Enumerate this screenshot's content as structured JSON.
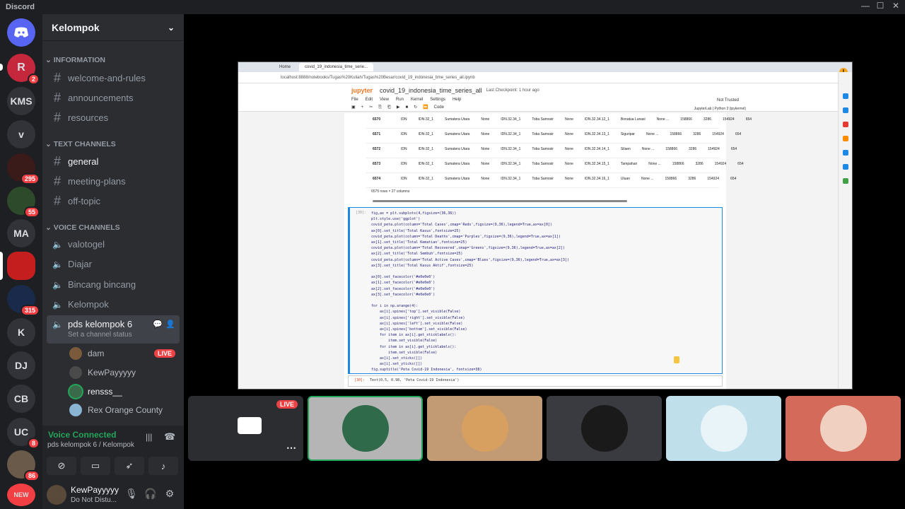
{
  "app": {
    "name": "Discord"
  },
  "window_controls": {
    "minimize": "—",
    "maximize": "☐",
    "close": "✕"
  },
  "servers": [
    {
      "label": "",
      "badge": "2"
    },
    {
      "label": "KMS",
      "badge": ""
    },
    {
      "label": "v",
      "badge": ""
    },
    {
      "label": "",
      "badge": "295"
    },
    {
      "label": "",
      "badge": "55"
    },
    {
      "label": "MA",
      "badge": ""
    },
    {
      "label": "",
      "badge": ""
    },
    {
      "label": "",
      "badge": "315"
    },
    {
      "label": "K",
      "badge": ""
    },
    {
      "label": "DJ",
      "badge": ""
    },
    {
      "label": "CB",
      "badge": ""
    },
    {
      "label": "UC",
      "badge": "8"
    },
    {
      "label": "",
      "badge": "86"
    },
    {
      "label": "NEW",
      "badge": ""
    }
  ],
  "guild": {
    "name": "Kelompok"
  },
  "categories": {
    "information": "INFORMATION",
    "text": "TEXT CHANNELS",
    "voice": "VOICE CHANNELS"
  },
  "info_channels": [
    "welcome-and-rules",
    "announcements",
    "resources"
  ],
  "text_channels": [
    "general",
    "meeting-plans",
    "off-topic"
  ],
  "voice_channels": [
    "valotogel",
    "Diajar",
    "Bincang bincang",
    "Kelompok"
  ],
  "active_voice": {
    "name": "pds kelompok 6",
    "status": "Set a channel status"
  },
  "voice_users": [
    {
      "name": "dam",
      "live": "LIVE"
    },
    {
      "name": "KewPayyyyy",
      "live": ""
    },
    {
      "name": "rensss__",
      "live": ""
    },
    {
      "name": "Rex Orange County",
      "live": ""
    }
  ],
  "voice_panel": {
    "title": "Voice Connected",
    "sub": "pds kelompok 6 / Kelompok"
  },
  "user": {
    "name": "KewPayyyyy",
    "status": "Do Not Distu..."
  },
  "screen": {
    "tabs": [
      "Home",
      "covid_19_indonesia_time_serie..."
    ],
    "address": "localhost:8888/notebooks/Tugas%20Kuliah/Tugas%20Besar/covid_19_indonesia_time_series_all.ipynb",
    "jupyter": "jupyter",
    "notebook": "covid_19_indonesia_time_series_all",
    "checkpoint": "Last Checkpoint: 1 hour ago",
    "menus": [
      "File",
      "Edit",
      "View",
      "Run",
      "Kernel",
      "Settings",
      "Help"
    ],
    "toolbar": [
      "▣",
      "+",
      "✂",
      "⎘",
      "⎗",
      "▶",
      "■",
      "↻",
      "⏩",
      "Code"
    ],
    "trust": "Not Trusted",
    "kernel": "JupyterLab  |  Python 3 (ipykernel)",
    "rows": [
      {
        "i": "6570",
        "a": "IDN",
        "b": "IDN-32_1",
        "c": "Sumatera Utara",
        "d": "None",
        "e": "IDN.32.34_1",
        "f": "Toba Samosir",
        "g": "None",
        "h": "IDN.32.34.12_1",
        "k": "Bonatua Lunasi",
        "l": "None ...",
        "m": "158866",
        "n": "3286",
        "o": "154924",
        "p": "654"
      },
      {
        "i": "6571",
        "a": "IDN",
        "b": "IDN-32_1",
        "c": "Sumatera Utara",
        "d": "None",
        "e": "IDN.32.34_1",
        "f": "Toba Samosir",
        "g": "None",
        "h": "IDN.32.34.13_1",
        "k": "Siguripar",
        "l": "None ...",
        "m": "158866",
        "n": "3286",
        "o": "154924",
        "p": "654"
      },
      {
        "i": "6572",
        "a": "IDN",
        "b": "IDN-32_1",
        "c": "Sumatera Utara",
        "d": "None",
        "e": "IDN.32.34_1",
        "f": "Toba Samosir",
        "g": "None",
        "h": "IDN.32.34.14_1",
        "k": "Silaen",
        "l": "None ...",
        "m": "158866",
        "n": "3286",
        "o": "154924",
        "p": "654"
      },
      {
        "i": "6573",
        "a": "IDN",
        "b": "IDN-32_1",
        "c": "Sumatera Utara",
        "d": "None",
        "e": "IDN.32.34_1",
        "f": "Toba Samosir",
        "g": "None",
        "h": "IDN.32.34.15_1",
        "k": "Tampahan",
        "l": "None ...",
        "m": "158866",
        "n": "3286",
        "o": "154924",
        "p": "654"
      },
      {
        "i": "6574",
        "a": "IDN",
        "b": "IDN-32_1",
        "c": "Sumatera Utara",
        "d": "None",
        "e": "IDN.32.34_1",
        "f": "Toba Samosir",
        "g": "None",
        "h": "IDN.32.34.16_1",
        "k": "Uluan",
        "l": "None ...",
        "m": "158866",
        "n": "3286",
        "o": "154924",
        "p": "654"
      }
    ],
    "summary": "6575 rows × 27 columns",
    "cell_prompt": "[30]:",
    "code": "fig,ax = plt.subplots(4,figsize=(36,36))\nplt.style.use('ggplot')\ncovid_peta.plot(column='Total Cases',cmap='Reds',figsize=(9,36),legend=True,ax=ax[0])\nax[0].set_title('Total Kasus',fontsize=25)\ncovid_peta.plot(column='Total Deaths',cmap='Purples',figsize=(9,36),legend=True,ax=ax[1])\nax[1].set_title('Total Kematian',fontsize=25)\ncovid_peta.plot(column='Total Recovered',cmap='Greens',figsize=(9,36),legend=True,ax=ax[2])\nax[2].set_title('Total Sembuh',fontsize=25)\ncovid_peta.plot(column='Total Active Cases',cmap='Blues',figsize=(9,36),legend=True,ax=ax[3])\nax[3].set_title('Total Kasus Aktif',fontsize=25)\n\nax[0].set_facecolor('#e0e0e0')\nax[1].set_facecolor('#e0e0e0')\nax[2].set_facecolor('#e0e0e0')\nax[3].set_facecolor('#e0e0e0')\n\nfor i in np.arange(4):\n    ax[i].spines['top'].set_visible(False)\n    ax[i].spines['right'].set_visible(False)\n    ax[i].spines['left'].set_visible(False)\n    ax[i].spines['bottom'].set_visible(False)\n    for item in ax[i].get_xticklabels():\n        item.set_visible(False)\n    for item in ax[i].get_yticklabels():\n        item.set_visible(False)\n    ax[i].set_xticks([])\n    ax[i].set_yticks([])\nfig.suptitle('Peta Covid-19 Indonesia', fontsize=38)",
    "out_prompt": "[30]:",
    "out_text": "Text(0.5, 0.98, 'Peta Covid-19 Indonesia')"
  },
  "stream_tiles": [
    {
      "live": "LIVE"
    },
    {
      "live": ""
    },
    {
      "live": ""
    },
    {
      "live": ""
    },
    {
      "live": ""
    },
    {
      "live": ""
    }
  ],
  "colors": {
    "accent": "#5865f2",
    "live": "#ed4245",
    "connected": "#23a55a"
  }
}
